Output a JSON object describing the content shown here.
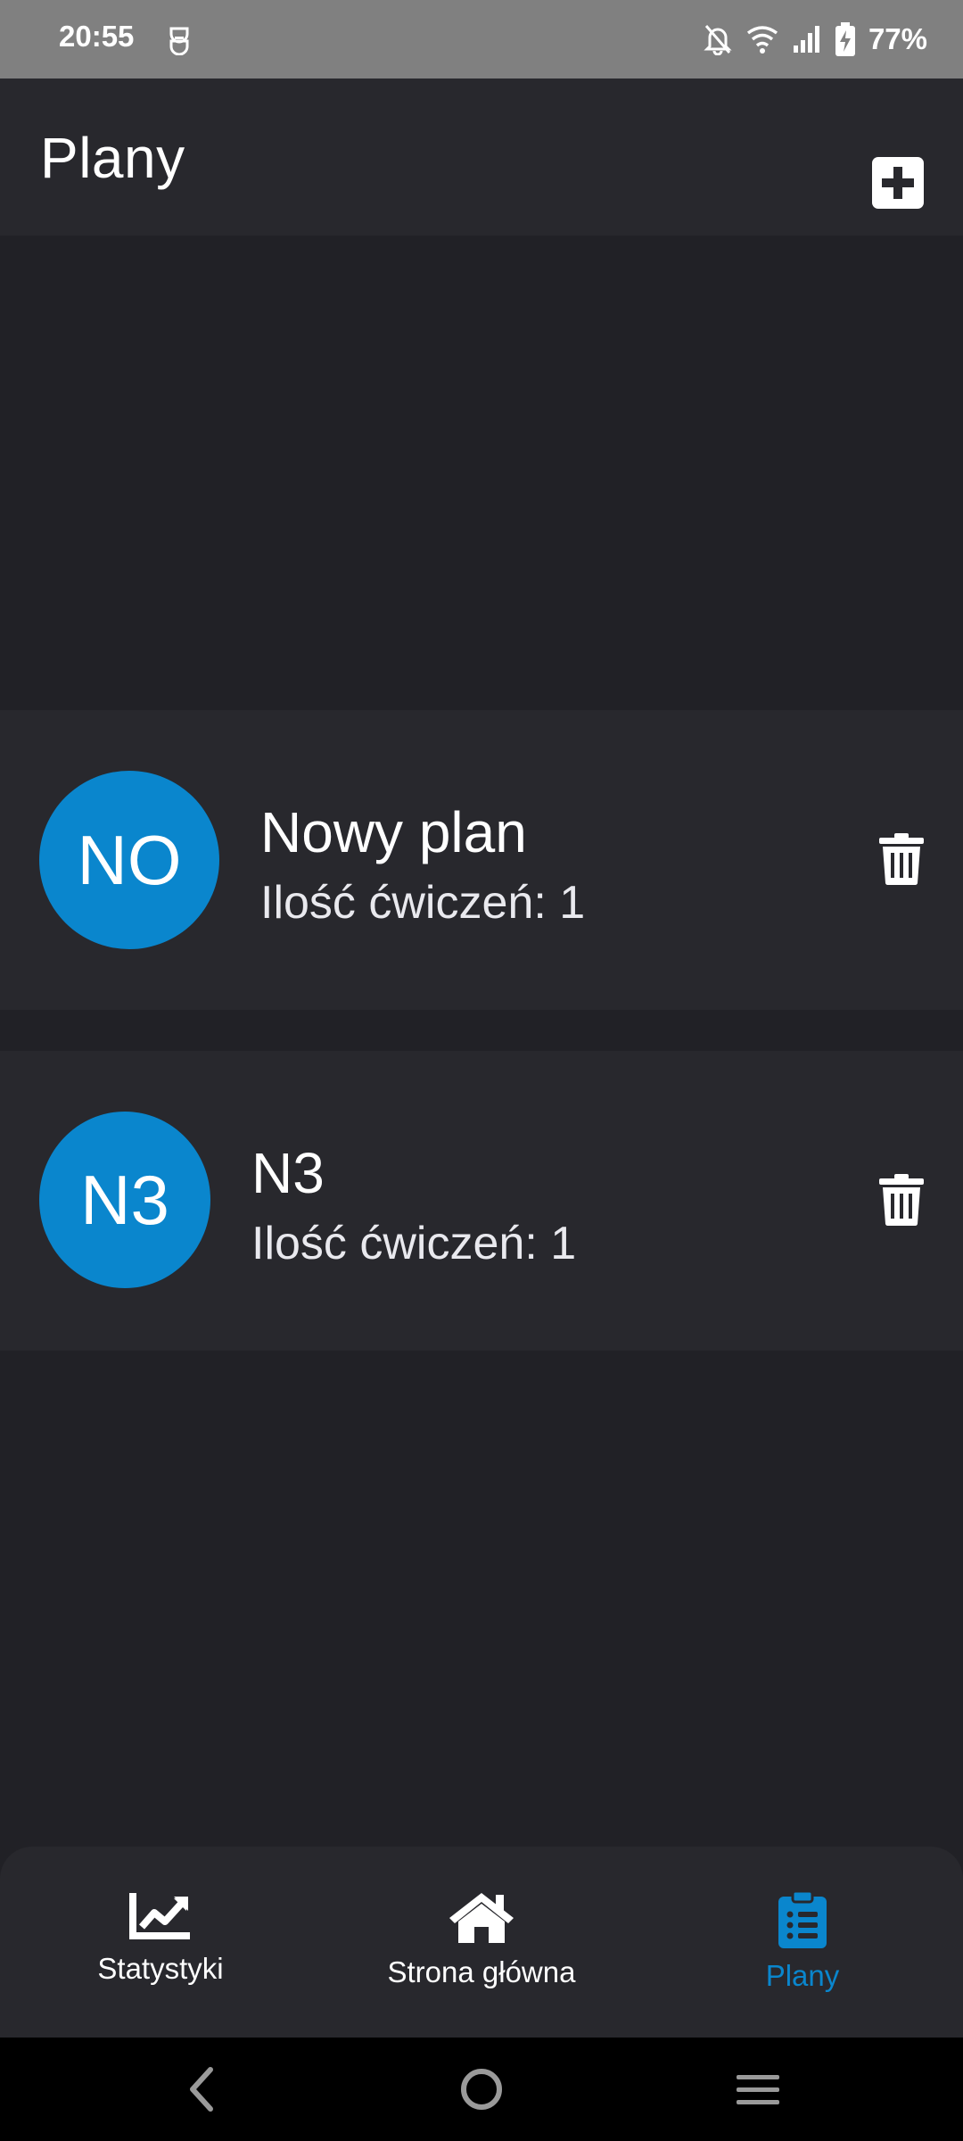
{
  "status_bar": {
    "time": "20:55",
    "battery_percent": "77%"
  },
  "header": {
    "title": "Plany"
  },
  "plans": [
    {
      "initials": "NO",
      "name": "Nowy plan",
      "exercise_count": "Ilość ćwiczeń: 1"
    },
    {
      "initials": "N3",
      "name": "N3",
      "exercise_count": "Ilość ćwiczeń: 1"
    }
  ],
  "bottom_nav": {
    "items": [
      {
        "label": "Statystyki",
        "icon": "chart-line-icon",
        "active": false
      },
      {
        "label": "Strona główna",
        "icon": "home-icon",
        "active": false
      },
      {
        "label": "Plany",
        "icon": "clipboard-list-icon",
        "active": true
      }
    ]
  },
  "colors": {
    "accent": "#0a86cd",
    "background": "#212126",
    "surface": "#28282d",
    "status_bar": "#808080"
  }
}
